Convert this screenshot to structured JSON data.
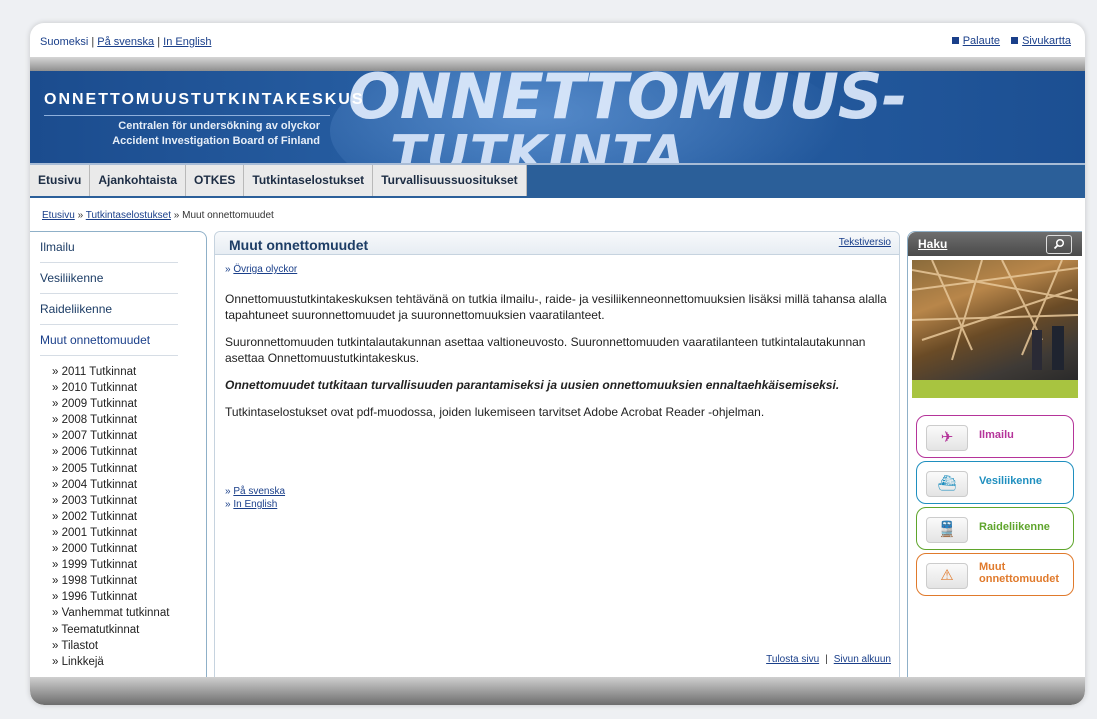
{
  "topbar": {
    "lang_current": "Suomeksi",
    "lang_sv": "På svenska",
    "lang_en": "In English",
    "feedback": "Palaute",
    "sitemap": "Sivukartta"
  },
  "banner": {
    "org": "ONNETTOMUUSTUTKINTAKESKUS",
    "sub1": "Centralen för undersökning av olyckor",
    "sub2": "Accident Investigation Board of Finland",
    "big1": "ONNETTOMUUS-",
    "big2": "TUTKINTA"
  },
  "nav": {
    "tabs": [
      "Etusivu",
      "Ajankohtaista",
      "OTKES",
      "Tutkintaselostukset",
      "Turvallisuussuositukset"
    ]
  },
  "breadcrumb": {
    "home": "Etusivu",
    "sep": "»",
    "level1": "Tutkintaselostukset",
    "current": "Muut onnettomuudet"
  },
  "leftnav": {
    "items": [
      "Ilmailu",
      "Vesiliikenne",
      "Raideliikenne",
      "Muut onnettomuudet"
    ],
    "sub": [
      "2011 Tutkinnat",
      "2010 Tutkinnat",
      "2009 Tutkinnat",
      "2008 Tutkinnat",
      "2007 Tutkinnat",
      "2006 Tutkinnat",
      "2005 Tutkinnat",
      "2004 Tutkinnat",
      "2003 Tutkinnat",
      "2002 Tutkinnat",
      "2001 Tutkinnat",
      "2000 Tutkinnat",
      "1999 Tutkinnat",
      "1998 Tutkinnat",
      "1996 Tutkinnat",
      "Vanhemmat tutkinnat",
      "Teematutkinnat",
      "Tilastot",
      "Linkkejä"
    ]
  },
  "main": {
    "title": "Muut onnettomuudet",
    "text_version": "Tekstiversio",
    "alt_lang": "Övriga olyckor",
    "p1": "Onnettomuustutkintakeskuksen tehtävänä on tutkia ilmailu-, raide- ja vesiliikenneonnettomuuksien lisäksi millä tahansa alalla tapahtuneet suuronnettomuudet ja suuronnettomuuksien vaaratilanteet.",
    "p2": "Suuronnettomuuden tutkintalautakunnan asettaa valtioneuvosto. Suuronnettomuuden vaaratilanteen tutkintalautakunnan asettaa Onnettomuustutkintakeskus.",
    "p3": "Onnettomuudet tutkitaan turvallisuuden parantamiseksi ja uusien onnettomuuksien ennaltaehkäisemiseksi.",
    "p4": "Tutkintaselostukset ovat pdf-muodossa, joiden lukemiseen tarvitset Adobe Acrobat Reader -ohjelman.",
    "link_sv": "På svenska",
    "link_en": "In English",
    "print": "Tulosta sivu",
    "top": "Sivun alkuun"
  },
  "right": {
    "search": "Haku",
    "search_icon": "magnifier-icon",
    "categories": [
      {
        "label": "Ilmailu",
        "color": "#b5349a",
        "icon": "airplane-icon",
        "glyph": "✈"
      },
      {
        "label": "Vesiliikenne",
        "color": "#1f8fbf",
        "icon": "ship-icon",
        "glyph": "⛴"
      },
      {
        "label": "Raideliikenne",
        "color": "#5fa52c",
        "icon": "train-icon",
        "glyph": "🚆"
      },
      {
        "label": "Muut onnettomuudet",
        "label_line1": "Muut",
        "label_line2": "onnettomuudet",
        "color": "#e07a2c",
        "icon": "warning-icon",
        "glyph": "⚠"
      }
    ]
  },
  "colors": {
    "banner_blue": "#1b4c8e",
    "nav_blue": "#2b5f99",
    "link": "#1a3f8a"
  }
}
